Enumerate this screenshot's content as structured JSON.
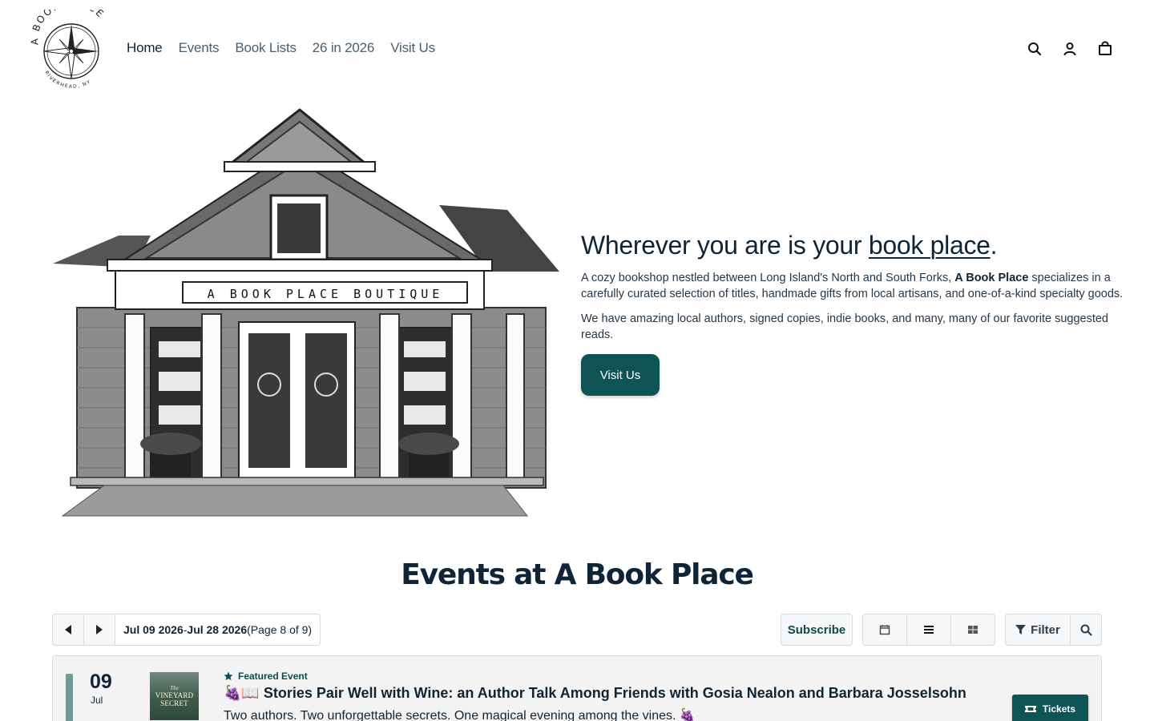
{
  "brand": {
    "logo_top_text": "A BOOK PLACE",
    "logo_bottom_text": "RIVERHEAD, NY"
  },
  "nav": {
    "items": [
      {
        "label": "Home",
        "active": true
      },
      {
        "label": "Events",
        "active": false
      },
      {
        "label": "Book Lists",
        "active": false
      },
      {
        "label": "26 in 2026",
        "active": false
      },
      {
        "label": "Visit Us",
        "active": false
      }
    ]
  },
  "header_icons": [
    "search-icon",
    "account-icon",
    "cart-icon"
  ],
  "hero": {
    "illustration_sign": "A BOOK PLACE BOUTIQUE",
    "title_prefix": "Wherever you are is your ",
    "title_link": "book place",
    "title_suffix": ".",
    "p1_before": "A cozy bookshop nestled between Long Island's North and South Forks, ",
    "p1_bold": "A Book Place",
    "p1_after": " specializes in a carefully curated selection of titles, handmade gifts from local artisans, and one-of-a-kind specialty goods.",
    "p2": "We have amazing local authors, signed copies, indie books, and many, many of our favorite suggested reads.",
    "cta": "Visit Us"
  },
  "events": {
    "heading": "Events at A Book Place",
    "toolbar": {
      "range_start": "Jul 09 2026",
      "range_sep": " - ",
      "range_end": "Jul 28 2026",
      "page_info": " (Page 8 of 9)",
      "subscribe": "Subscribe",
      "filter": "Filter",
      "view_icons": [
        "calendar-icon",
        "list-icon",
        "grid-icon"
      ]
    },
    "items": [
      {
        "day": "09",
        "month": "Jul",
        "thumb_line1": "The",
        "thumb_line2": "VINEYARD SECRET",
        "featured_label": "Featured Event",
        "title": "🍇📖 Stories Pair Well with Wine: an Author Talk Among Friends with Gosia Nealon and Barbara Josselsohn",
        "description": "Two authors. Two unforgettable secrets. One magical evening among the vines. 🍇",
        "tickets_label": "Tickets"
      }
    ]
  },
  "colors": {
    "primary": "#0f5454",
    "text": "#0f2436",
    "event_bar": "#6d9c96"
  }
}
